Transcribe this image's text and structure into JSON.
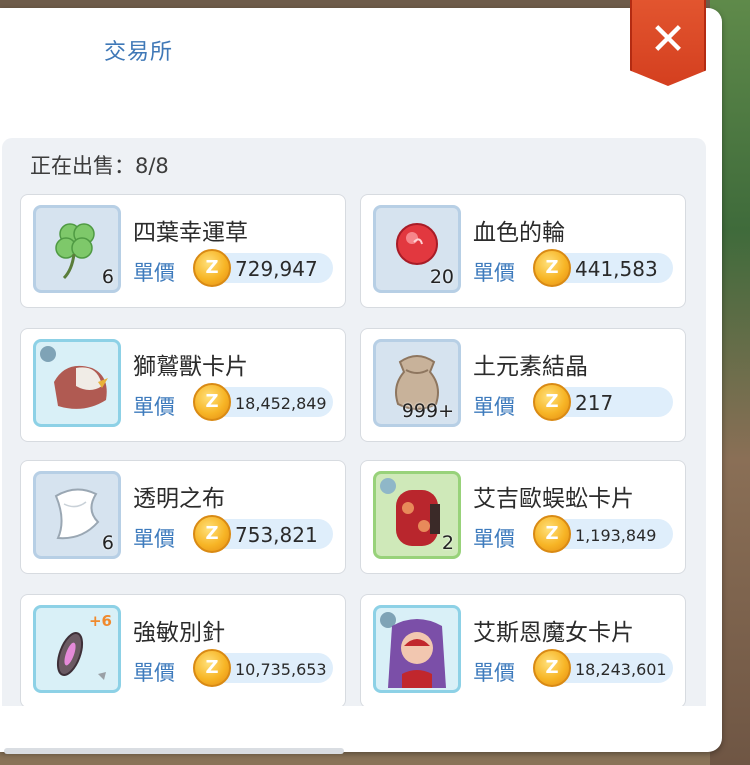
{
  "window": {
    "title": "交易所",
    "close_icon": "close-icon"
  },
  "listing": {
    "on_sale_label": "正在出售：8/8"
  },
  "price_label": "單價",
  "items": [
    {
      "name": "四葉幸運草",
      "qty": "6",
      "price": "729,947",
      "plus": "",
      "icon": "clover-icon"
    },
    {
      "name": "血色的輪",
      "qty": "20",
      "price": "441,583",
      "plus": "",
      "icon": "red-orb-icon"
    },
    {
      "name": "獅鷲獸卡片",
      "qty": "",
      "price": "18,452,849",
      "plus": "",
      "icon": "griffin-card-icon"
    },
    {
      "name": "土元素結晶",
      "qty": "999+",
      "price": "217",
      "plus": "",
      "icon": "sack-icon"
    },
    {
      "name": "透明之布",
      "qty": "6",
      "price": "753,821",
      "plus": "",
      "icon": "cloth-icon"
    },
    {
      "name": "艾吉歐蜈蚣卡片",
      "qty": "2",
      "price": "1,193,849",
      "plus": "",
      "icon": "centipede-card-icon"
    },
    {
      "name": "強敏別針",
      "qty": "",
      "price": "10,735,653",
      "plus": "+6",
      "icon": "brooch-icon"
    },
    {
      "name": "艾斯恩魔女卡片",
      "qty": "",
      "price": "18,243,601",
      "plus": "",
      "icon": "witch-card-icon"
    }
  ],
  "colors": {
    "accent": "#3e7bbd",
    "close": "#d94a26",
    "coin": "#f7b526"
  }
}
